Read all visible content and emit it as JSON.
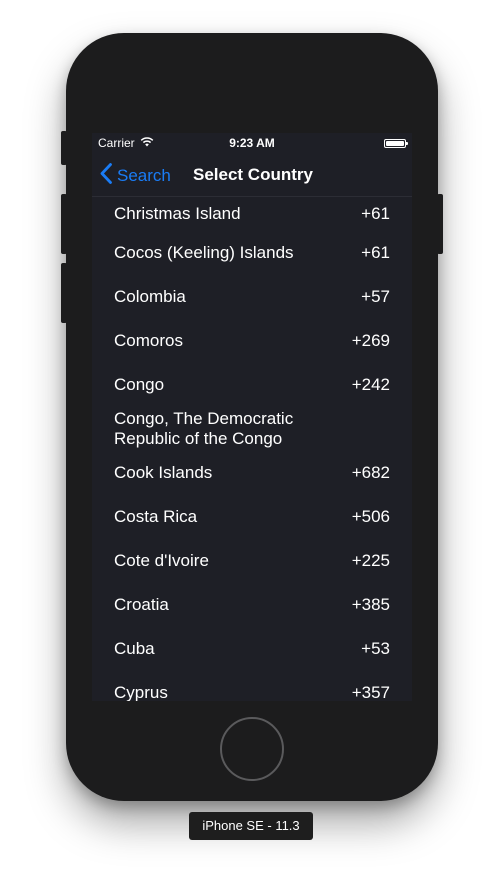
{
  "status_bar": {
    "carrier": "Carrier",
    "time": "9:23 AM"
  },
  "nav": {
    "back_label": "Search",
    "title": "Select Country"
  },
  "countries": [
    {
      "name": "Christmas Island",
      "code": "+61"
    },
    {
      "name": "Cocos (Keeling) Islands",
      "code": "+61"
    },
    {
      "name": "Colombia",
      "code": "+57"
    },
    {
      "name": "Comoros",
      "code": "+269"
    },
    {
      "name": "Congo",
      "code": "+242"
    },
    {
      "name": "Congo, The Democratic Republic of the Congo",
      "code": ""
    },
    {
      "name": "Cook Islands",
      "code": "+682"
    },
    {
      "name": "Costa Rica",
      "code": "+506"
    },
    {
      "name": "Cote d'Ivoire",
      "code": "+225"
    },
    {
      "name": "Croatia",
      "code": "+385"
    },
    {
      "name": "Cuba",
      "code": "+53"
    },
    {
      "name": "Cyprus",
      "code": "+357"
    }
  ],
  "device_label": "iPhone SE - 11.3",
  "colors": {
    "accent": "#1a7cf5",
    "background": "#1e1f26",
    "device_body": "#1c1c1d"
  },
  "icons": [
    "wifi-icon",
    "battery-icon",
    "chevron-left-icon"
  ]
}
